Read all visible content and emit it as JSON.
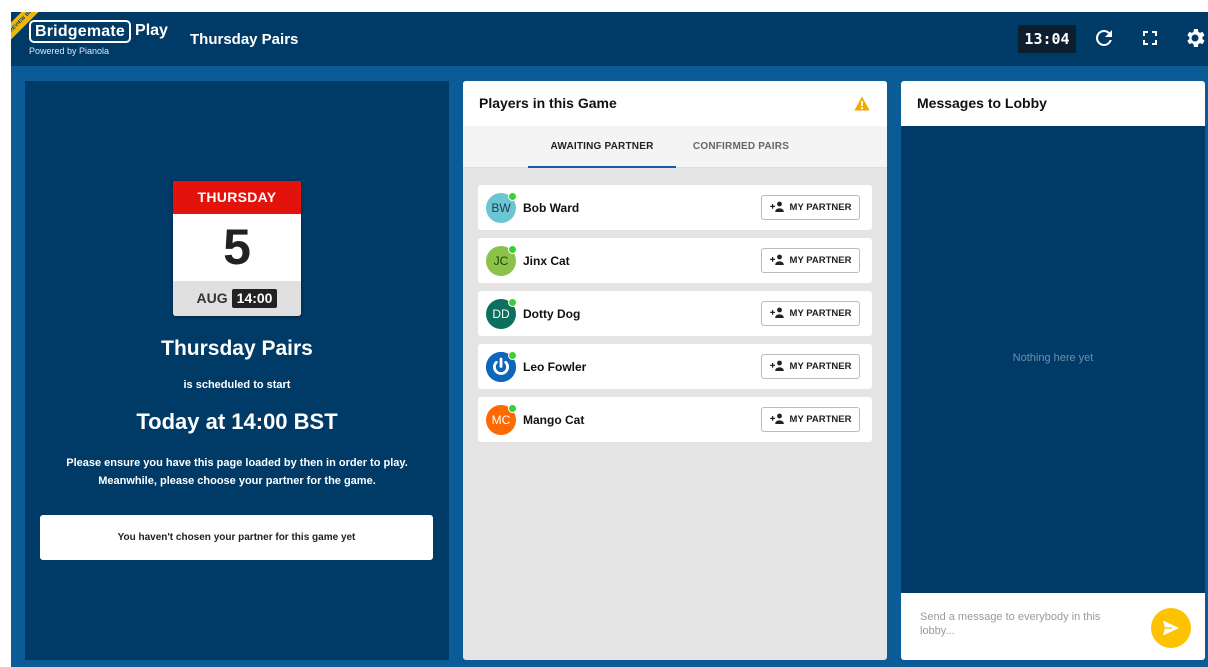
{
  "header": {
    "logo_text": "Bridgemate",
    "logo_play": "Play",
    "powered_by": "Powered by Pianola",
    "beta_badge": "PREVIEW BETA",
    "game_title": "Thursday Pairs",
    "clock": "13:04",
    "icons": [
      "refresh-icon",
      "fullscreen-icon",
      "gear-icon"
    ]
  },
  "event": {
    "calendar_day": "THURSDAY",
    "calendar_date": "5",
    "calendar_month": "AUG",
    "calendar_time": "14:00",
    "title": "Thursday Pairs",
    "scheduled_text": "is scheduled to start",
    "start_time": "Today at 14:00 BST",
    "note_line1": "Please ensure you have this page loaded by then in order to play.",
    "note_line2": "Meanwhile, please choose your partner for the game.",
    "partner_status": "You haven't chosen your partner for this game yet"
  },
  "players_panel": {
    "title": "Players in this Game",
    "tabs": [
      "AWAITING PARTNER",
      "CONFIRMED PAIRS"
    ],
    "active_tab": "AWAITING PARTNER",
    "button_label": "MY PARTNER",
    "players": [
      {
        "initials": "BW",
        "name": "Bob Ward",
        "online": true,
        "avatar_color": "#6cc5d3"
      },
      {
        "initials": "JC",
        "name": "Jinx Cat",
        "online": true,
        "avatar_color": "#8bc34a"
      },
      {
        "initials": "DD",
        "name": "Dotty Dog",
        "online": true,
        "avatar_color": "#0d6f5e"
      },
      {
        "initials": "",
        "name": "Leo Fowler",
        "online": true,
        "avatar_color": "#0e66b8",
        "avatar_icon": "power-icon"
      },
      {
        "initials": "MC",
        "name": "Mango Cat",
        "online": true,
        "avatar_color": "#ff6a00"
      }
    ]
  },
  "messages_panel": {
    "title": "Messages to Lobby",
    "empty_text": "Nothing here yet",
    "compose_placeholder": "Send a message to everybody in this lobby..."
  },
  "colors": {
    "header_bg": "#003a66",
    "page_bg": "#0b5c96",
    "calendar_red": "#e3120b",
    "send_button": "#fdc300",
    "online": "#3ccf35",
    "warning": "#f2a900"
  }
}
